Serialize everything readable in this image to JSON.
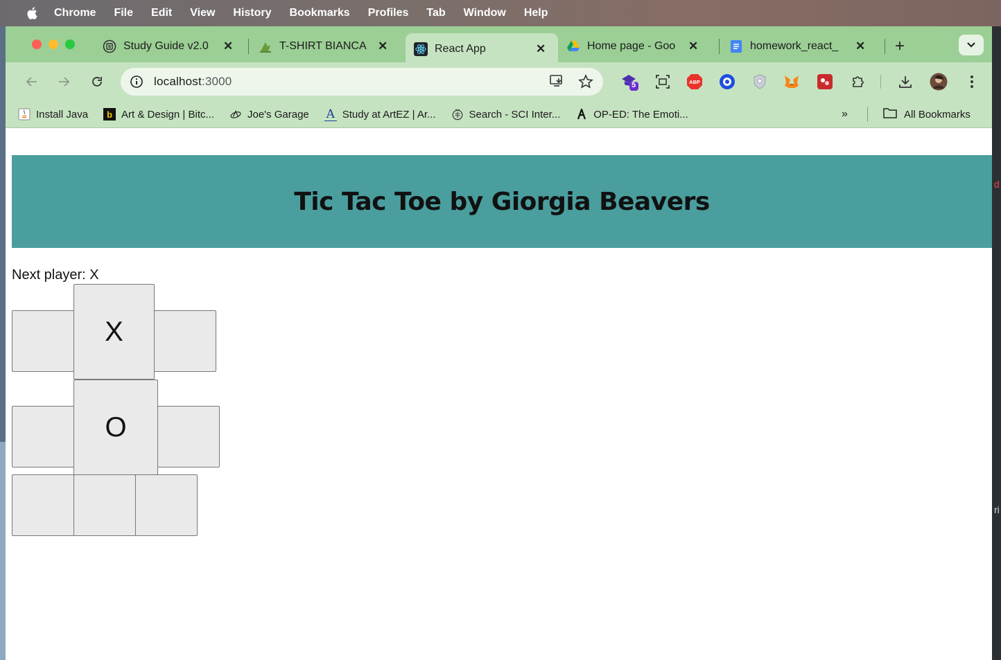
{
  "menubar": {
    "items": [
      "Chrome",
      "File",
      "Edit",
      "View",
      "History",
      "Bookmarks",
      "Profiles",
      "Tab",
      "Window",
      "Help"
    ]
  },
  "tabs": [
    {
      "title": "Study Guide v2.0",
      "icon": "study-guide-icon",
      "active": false
    },
    {
      "title": "T-SHIRT BIANCA",
      "icon": "tshirt-icon",
      "active": false
    },
    {
      "title": "React App",
      "icon": "react-icon",
      "active": true
    },
    {
      "title": "Home page - Goo",
      "icon": "google-drive-icon",
      "active": false
    },
    {
      "title": "homework_react_",
      "icon": "google-docs-icon",
      "active": false
    }
  ],
  "toolbar": {
    "url_host": "localhost",
    "url_port": ":3000",
    "extension_badge": "5"
  },
  "bookmarks": {
    "items": [
      {
        "label": "Install Java",
        "icon": "java-icon"
      },
      {
        "label": "Art & Design | Bitc...",
        "icon": "b-icon"
      },
      {
        "label": "Joe's Garage",
        "icon": "garage-icon"
      },
      {
        "label": "Study at ArtEZ | Ar...",
        "icon": "artez-icon"
      },
      {
        "label": "Search - SCI Inter...",
        "icon": "sci-icon"
      },
      {
        "label": "OP-ED: The Emoti...",
        "icon": "a-icon"
      }
    ],
    "more": "»",
    "all_label": "All Bookmarks"
  },
  "page": {
    "title": "Tic Tac Toe by Giorgia Beavers",
    "status": "Next player: X",
    "squares": [
      "",
      "X",
      "",
      "",
      "O",
      "",
      "",
      "",
      ""
    ]
  },
  "colors": {
    "tabstrip": "#9bcf95",
    "toolbar": "#c6e3c1",
    "header": "#4a9e9e"
  }
}
